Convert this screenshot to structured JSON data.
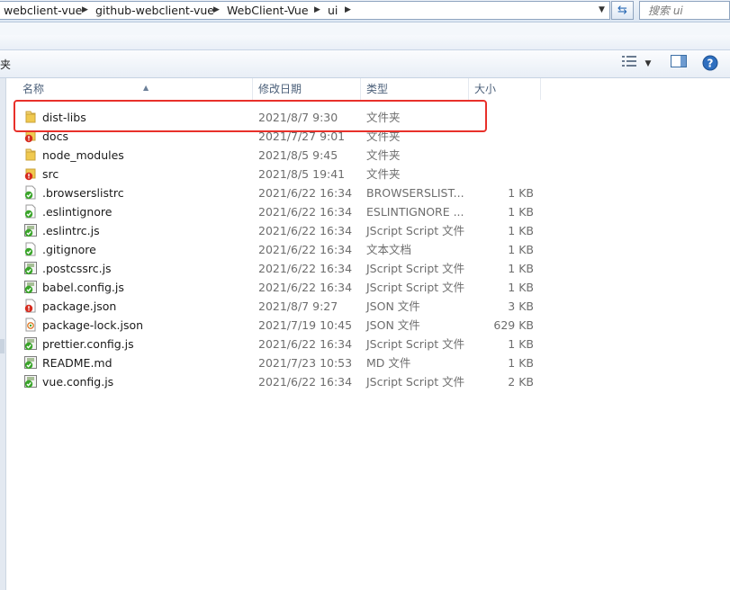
{
  "address_bar": {
    "crumbs": [
      "webclient-vue",
      "github-webclient-vue",
      "WebClient-Vue",
      "ui"
    ]
  },
  "search": {
    "placeholder": "搜索 ui"
  },
  "toolbar": {
    "partial_label": "夹"
  },
  "columns": {
    "name": "名称",
    "date_modified": "修改日期",
    "type": "类型",
    "size": "大小"
  },
  "files": [
    {
      "name": "dist-libs",
      "date": "2021/8/7 9:30",
      "type": "文件夹",
      "size": "",
      "icon": "folder-icon"
    },
    {
      "name": "docs",
      "date": "2021/7/27 9:01",
      "type": "文件夹",
      "size": "",
      "icon": "folder-error-icon"
    },
    {
      "name": "node_modules",
      "date": "2021/8/5 9:45",
      "type": "文件夹",
      "size": "",
      "icon": "folder-icon"
    },
    {
      "name": "src",
      "date": "2021/8/5 19:41",
      "type": "文件夹",
      "size": "",
      "icon": "folder-error-icon"
    },
    {
      "name": ".browserslistrc",
      "date": "2021/6/22 16:34",
      "type": "BROWSERSLIST...",
      "size": "1 KB",
      "icon": "file-check-icon"
    },
    {
      "name": ".eslintignore",
      "date": "2021/6/22 16:34",
      "type": "ESLINTIGNORE ...",
      "size": "1 KB",
      "icon": "file-check-icon"
    },
    {
      "name": ".eslintrc.js",
      "date": "2021/6/22 16:34",
      "type": "JScript Script 文件",
      "size": "1 KB",
      "icon": "script-check-icon"
    },
    {
      "name": ".gitignore",
      "date": "2021/6/22 16:34",
      "type": "文本文档",
      "size": "1 KB",
      "icon": "file-check-icon"
    },
    {
      "name": ".postcssrc.js",
      "date": "2021/6/22 16:34",
      "type": "JScript Script 文件",
      "size": "1 KB",
      "icon": "script-check-icon"
    },
    {
      "name": "babel.config.js",
      "date": "2021/6/22 16:34",
      "type": "JScript Script 文件",
      "size": "1 KB",
      "icon": "script-check-icon"
    },
    {
      "name": "package.json",
      "date": "2021/8/7 9:27",
      "type": "JSON 文件",
      "size": "3 KB",
      "icon": "file-error-icon"
    },
    {
      "name": "package-lock.json",
      "date": "2021/7/19 10:45",
      "type": "JSON 文件",
      "size": "629 KB",
      "icon": "file-modified-icon"
    },
    {
      "name": "prettier.config.js",
      "date": "2021/6/22 16:34",
      "type": "JScript Script 文件",
      "size": "1 KB",
      "icon": "script-check-icon"
    },
    {
      "name": "README.md",
      "date": "2021/7/23 10:53",
      "type": "MD 文件",
      "size": "1 KB",
      "icon": "script-check-icon"
    },
    {
      "name": "vue.config.js",
      "date": "2021/6/22 16:34",
      "type": "JScript Script 文件",
      "size": "2 KB",
      "icon": "script-check-icon"
    }
  ],
  "colors": {
    "highlight": "#e8302a",
    "status_ok": "#3aa52a",
    "status_error": "#d52b1e",
    "folder": "#e9c24c"
  }
}
